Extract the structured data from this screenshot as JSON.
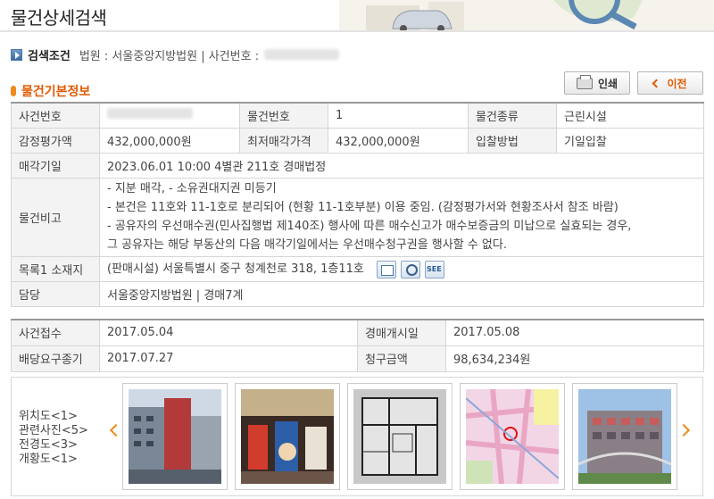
{
  "page": {
    "title": "물건상세검색"
  },
  "search_condition": {
    "label": "검색조건",
    "text": "법원 : 서울중앙지방법원 | 사건번호 :"
  },
  "buttons": {
    "print": "인쇄",
    "back": "이전"
  },
  "section": {
    "title": "물건기본정보"
  },
  "basic_info": {
    "case_no_label": "사건번호",
    "item_no_label": "물건번호",
    "item_no": "1",
    "item_type_label": "물건종류",
    "item_type": "근린시설",
    "appraisal_label": "감정평가액",
    "appraisal": "432,000,000원",
    "min_price_label": "최저매각가격",
    "min_price": "432,000,000원",
    "bid_method_label": "입찰방법",
    "bid_method": "기일입찰",
    "sale_date_label": "매각기일",
    "sale_date": "2023.06.01 10:00 4별관 211호 경매법정",
    "remarks_label": "물건비고",
    "remarks": [
      "- 지분 매각, - 소유권대지권 미등기",
      "- 본건은 11호와 11-1호로 분리되어 (현황 11-1호부분) 이용 중임. (감정평가서와 현황조사서 참조 바람)",
      "- 공유자의 우선매수권(민사집행법 제140조) 행사에 따른 매수신고가 매수보증금의 미납으로 실효되는 경우,",
      "그 공유자는 해당 부동산의 다음 매각기일에서는 우선매수청구권을 행사할 수 없다."
    ],
    "address_label": "목록1 소재지",
    "address": "(판매시설) 서울특별시 중구 청계천로 318, 1층11호",
    "address_icons": [
      "map-icon",
      "search-magnifier-icon",
      "see-real-icon"
    ],
    "manager_label": "담당",
    "manager": "서울중앙지방법원 | 경매7계"
  },
  "case_info": {
    "received_label": "사건접수",
    "received": "2017.05.04",
    "start_label": "경매개시일",
    "start": "2017.05.08",
    "deadline_label": "배당요구종기",
    "deadline": "2017.07.27",
    "claim_label": "청구금액",
    "claim": "98,634,234원"
  },
  "photos": {
    "labels": [
      "위치도<1>",
      "관련사진<5>",
      "전경도<3>",
      "개황도<1>"
    ],
    "thumbnails": [
      "building-exterior",
      "market-interior",
      "floor-plan",
      "location-map",
      "building-front"
    ]
  }
}
